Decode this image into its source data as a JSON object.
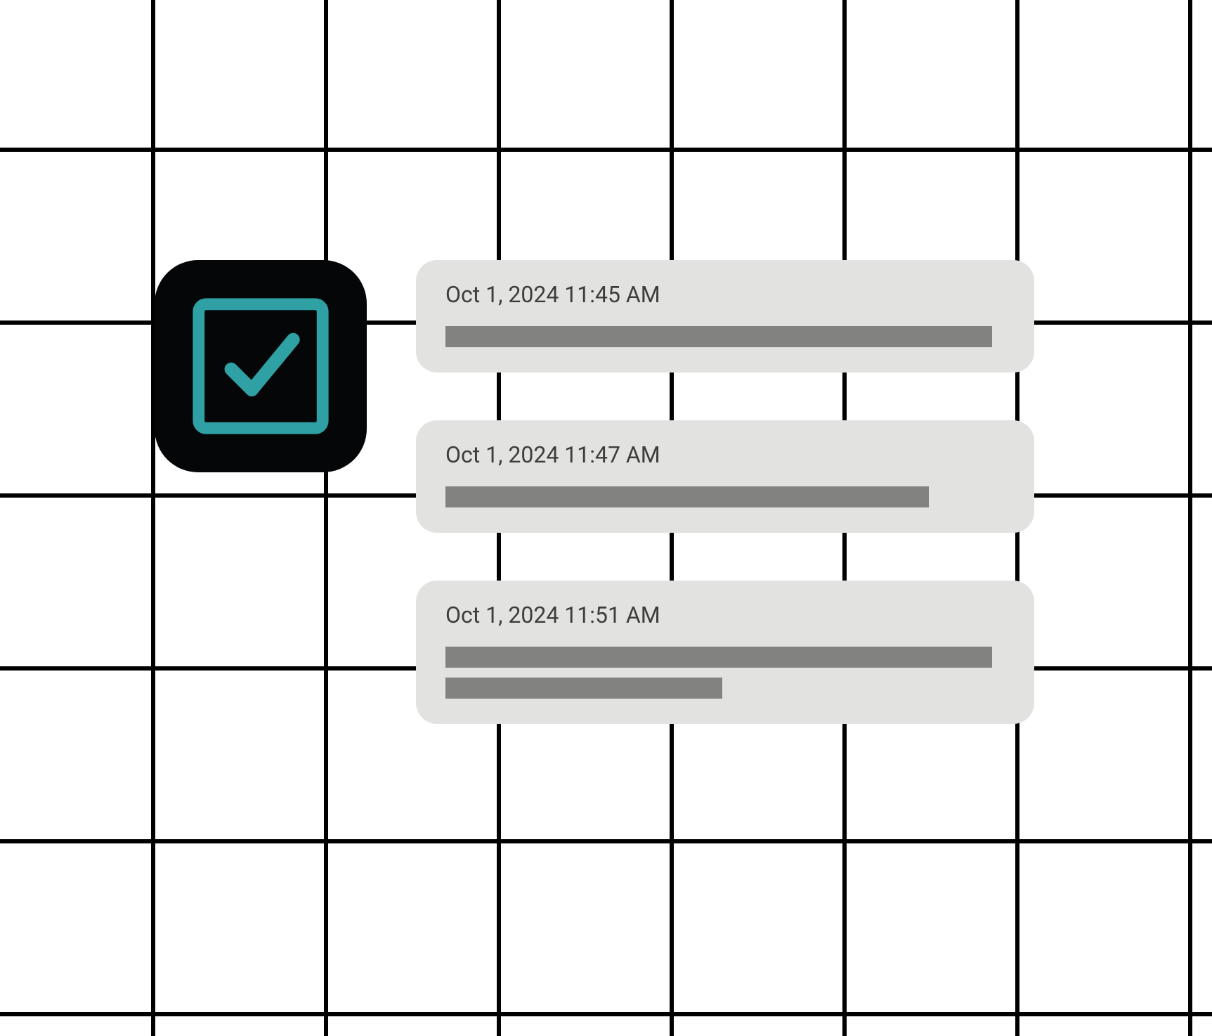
{
  "app_icon": {
    "name": "checkbox-checked-icon",
    "accent_color": "#2fa0a3",
    "background_color": "#050607"
  },
  "notifications": [
    {
      "timestamp": "Oct 1, 2024 11:45 AM",
      "bars": [
        "long"
      ]
    },
    {
      "timestamp": "Oct 1, 2024 11:47 AM",
      "bars": [
        "medium"
      ]
    },
    {
      "timestamp": "Oct 1, 2024 11:51 AM",
      "bars": [
        "long",
        "short"
      ]
    }
  ],
  "colors": {
    "card_background": "#e2e2e0",
    "bar_fill": "#828281",
    "text": "#3d3d3d"
  }
}
